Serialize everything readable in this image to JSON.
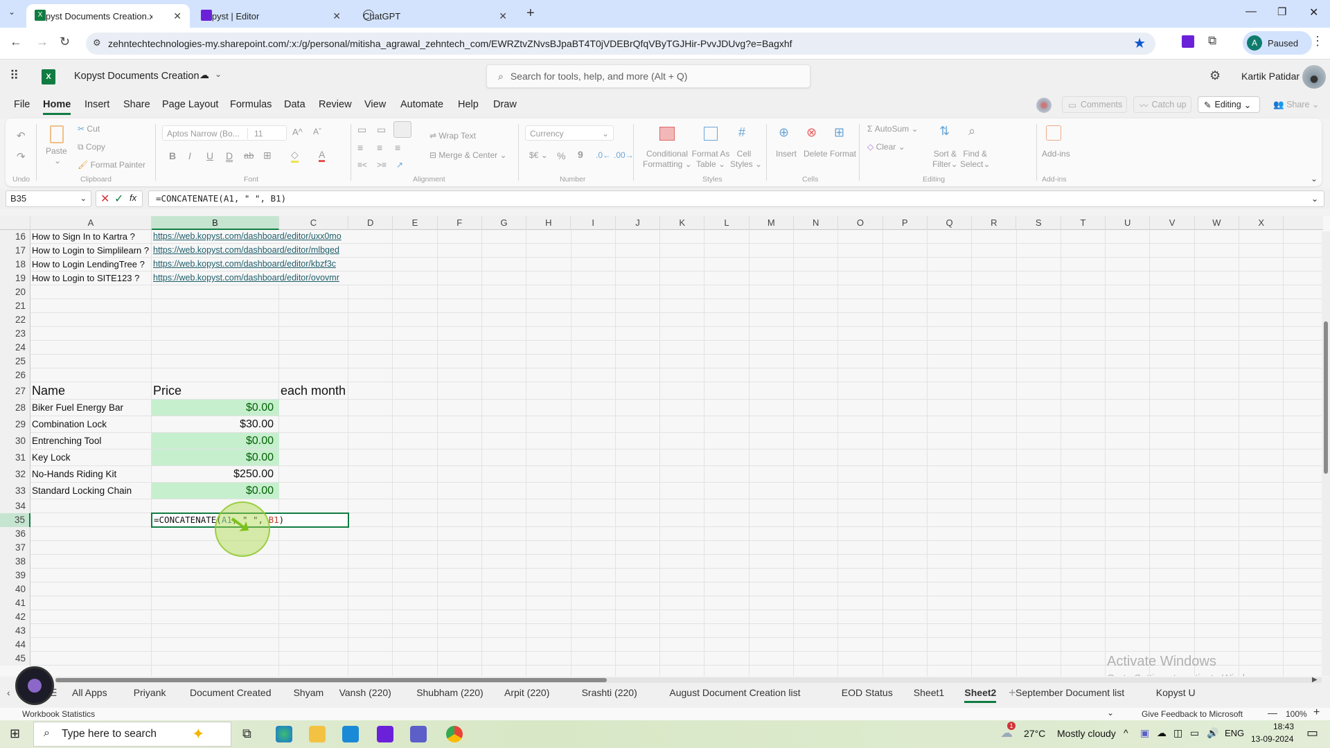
{
  "browser": {
    "tabs": [
      {
        "title": "Kopyst Documents Creation.xlsx",
        "icon": "excel-icon",
        "active": true
      },
      {
        "title": "Kopyst | Editor",
        "icon": "kopyst-icon",
        "active": false
      },
      {
        "title": "ChatGPT",
        "icon": "chatgpt-icon",
        "active": false
      }
    ],
    "url": "zehntechtechnologies-my.sharepoint.com/:x:/g/personal/mitisha_agrawal_zehntech_com/EWRZtvZNvsBJpaBT4T0jVDEBrQfqVByTGJHir-PvvJDUvg?e=Bagxhf",
    "profile_initial": "A",
    "profile_status": "Paused",
    "colors": {
      "tabbar": "#d3e3fd",
      "profile_badge": "#0f7b6c",
      "star": "#0b57d0"
    }
  },
  "app": {
    "doc_title": "Kopyst Documents Creation",
    "search_placeholder": "Search for tools, help, and more (Alt + Q)",
    "user_name": "Kartik Patidar",
    "brand_color": "#107c41"
  },
  "menu": {
    "items": [
      "File",
      "Home",
      "Insert",
      "Share",
      "Page Layout",
      "Formulas",
      "Data",
      "Review",
      "View",
      "Automate",
      "Help",
      "Draw"
    ],
    "active": "Home",
    "right": {
      "comments": "Comments",
      "catchup": "Catch up",
      "editing": "Editing",
      "share": "Share"
    }
  },
  "ribbon": {
    "undo_group": "Undo",
    "clipboard": {
      "paste": "Paste",
      "cut": "Cut",
      "copy": "Copy",
      "format_painter": "Format Painter",
      "group": "Clipboard"
    },
    "font": {
      "name": "Aptos Narrow (Bo...",
      "size": "11",
      "group": "Font"
    },
    "alignment": {
      "wrap": "Wrap Text",
      "merge": "Merge & Center",
      "group": "Alignment"
    },
    "number": {
      "format": "Currency",
      "currency": "$€",
      "percent": "%",
      "comma": "9",
      "group": "Number"
    },
    "styles": {
      "conditional": "Conditional",
      "conditional2": "Formatting",
      "table": "Format As",
      "table2": "Table",
      "cell": "Cell",
      "cell2": "Styles",
      "group": "Styles"
    },
    "cells": {
      "insert": "Insert",
      "delete": "Delete",
      "format": "Format",
      "group": "Cells"
    },
    "editing": {
      "autosum": "AutoSum",
      "clear": "Clear",
      "sort": "Sort &",
      "sort2": "Filter",
      "find": "Find &",
      "find2": "Select",
      "group": "Editing"
    },
    "addins": {
      "label": "Add-ins",
      "group": "Add-ins"
    }
  },
  "formula_bar": {
    "name_box": "B35",
    "formula": "=CONCATENATE(A1, \" \", B1)"
  },
  "sheet": {
    "columns": [
      "A",
      "B",
      "C",
      "D",
      "E",
      "F",
      "G",
      "H",
      "I",
      "J",
      "K",
      "L",
      "M",
      "N",
      "O",
      "P",
      "Q",
      "R",
      "S",
      "T",
      "U",
      "V",
      "W",
      "X"
    ],
    "selected_column": "B",
    "selected_row": "35",
    "row_numbers": [
      "16",
      "17",
      "18",
      "19",
      "20",
      "21",
      "22",
      "23",
      "24",
      "25",
      "26",
      "27",
      "28",
      "29",
      "30",
      "31",
      "32",
      "33",
      "34",
      "35",
      "36",
      "37",
      "38",
      "39",
      "40",
      "41",
      "42",
      "43",
      "44",
      "45"
    ],
    "link_rows": [
      {
        "row": "16",
        "a": "How to Sign In to Kartra ?",
        "b": "https://web.kopyst.com/dashboard/editor/uxx0mo"
      },
      {
        "row": "17",
        "a": "How to Login to Simplilearn ?",
        "b": "https://web.kopyst.com/dashboard/editor/mlbged"
      },
      {
        "row": "18",
        "a": "How to Login LendingTree ?",
        "b": "https://web.kopyst.com/dashboard/editor/kbzf3c"
      },
      {
        "row": "19",
        "a": "How to Login to SITE123 ?",
        "b": "https://web.kopyst.com/dashboard/editor/ovovmr"
      }
    ],
    "table_header": {
      "a": "Name",
      "b": "Price",
      "c": "each month"
    },
    "table_rows": [
      {
        "row": "28",
        "name": "Biker Fuel Energy Bar",
        "price": "$0.00",
        "highlight": true
      },
      {
        "row": "29",
        "name": "Combination Lock",
        "price": "$30.00",
        "highlight": false
      },
      {
        "row": "30",
        "name": "Entrenching Tool",
        "price": "$0.00",
        "highlight": true
      },
      {
        "row": "31",
        "name": "Key Lock",
        "price": "$0.00",
        "highlight": true
      },
      {
        "row": "32",
        "name": "No-Hands Riding Kit",
        "price": "$250.00",
        "highlight": false
      },
      {
        "row": "33",
        "name": "Standard Locking Chain",
        "price": "$0.00",
        "highlight": true
      }
    ],
    "editing_cell": {
      "ref": "B35",
      "parts": [
        {
          "text": "=CONCATENATE(",
          "color": "#111111"
        },
        {
          "text": "A1",
          "color": "#2b6cb0"
        },
        {
          "text": ", \" \", ",
          "color": "#111111"
        },
        {
          "text": "B1",
          "color": "#c0392b"
        },
        {
          "text": ")",
          "color": "#111111"
        }
      ]
    },
    "highlight_fill": "#c6efce",
    "highlight_text": "#006100"
  },
  "sheet_tabs": {
    "tabs": [
      "All Apps",
      "Priyank",
      "Document Created",
      "Shyam",
      "Vansh (220)",
      "Shubham (220)",
      "Arpit (220)",
      "Srashti (220)",
      "August Document Creation list",
      "EOD Status",
      "Sheet1",
      "Sheet2",
      "September Document list",
      "Kopyst U"
    ],
    "active": "Sheet2"
  },
  "status_bar": {
    "left": "Workbook Statistics",
    "feedback": "Give Feedback to Microsoft",
    "zoom": "100%"
  },
  "watermark": {
    "line1": "Activate Windows",
    "line2": "Go to Settings to activate Windows."
  },
  "taskbar": {
    "search_placeholder": "Type here to search",
    "weather_temp": "27°C",
    "weather_text": "Mostly cloudy",
    "weather_badge": "1",
    "language": "ENG",
    "time": "18:43",
    "date": "13-09-2024"
  }
}
